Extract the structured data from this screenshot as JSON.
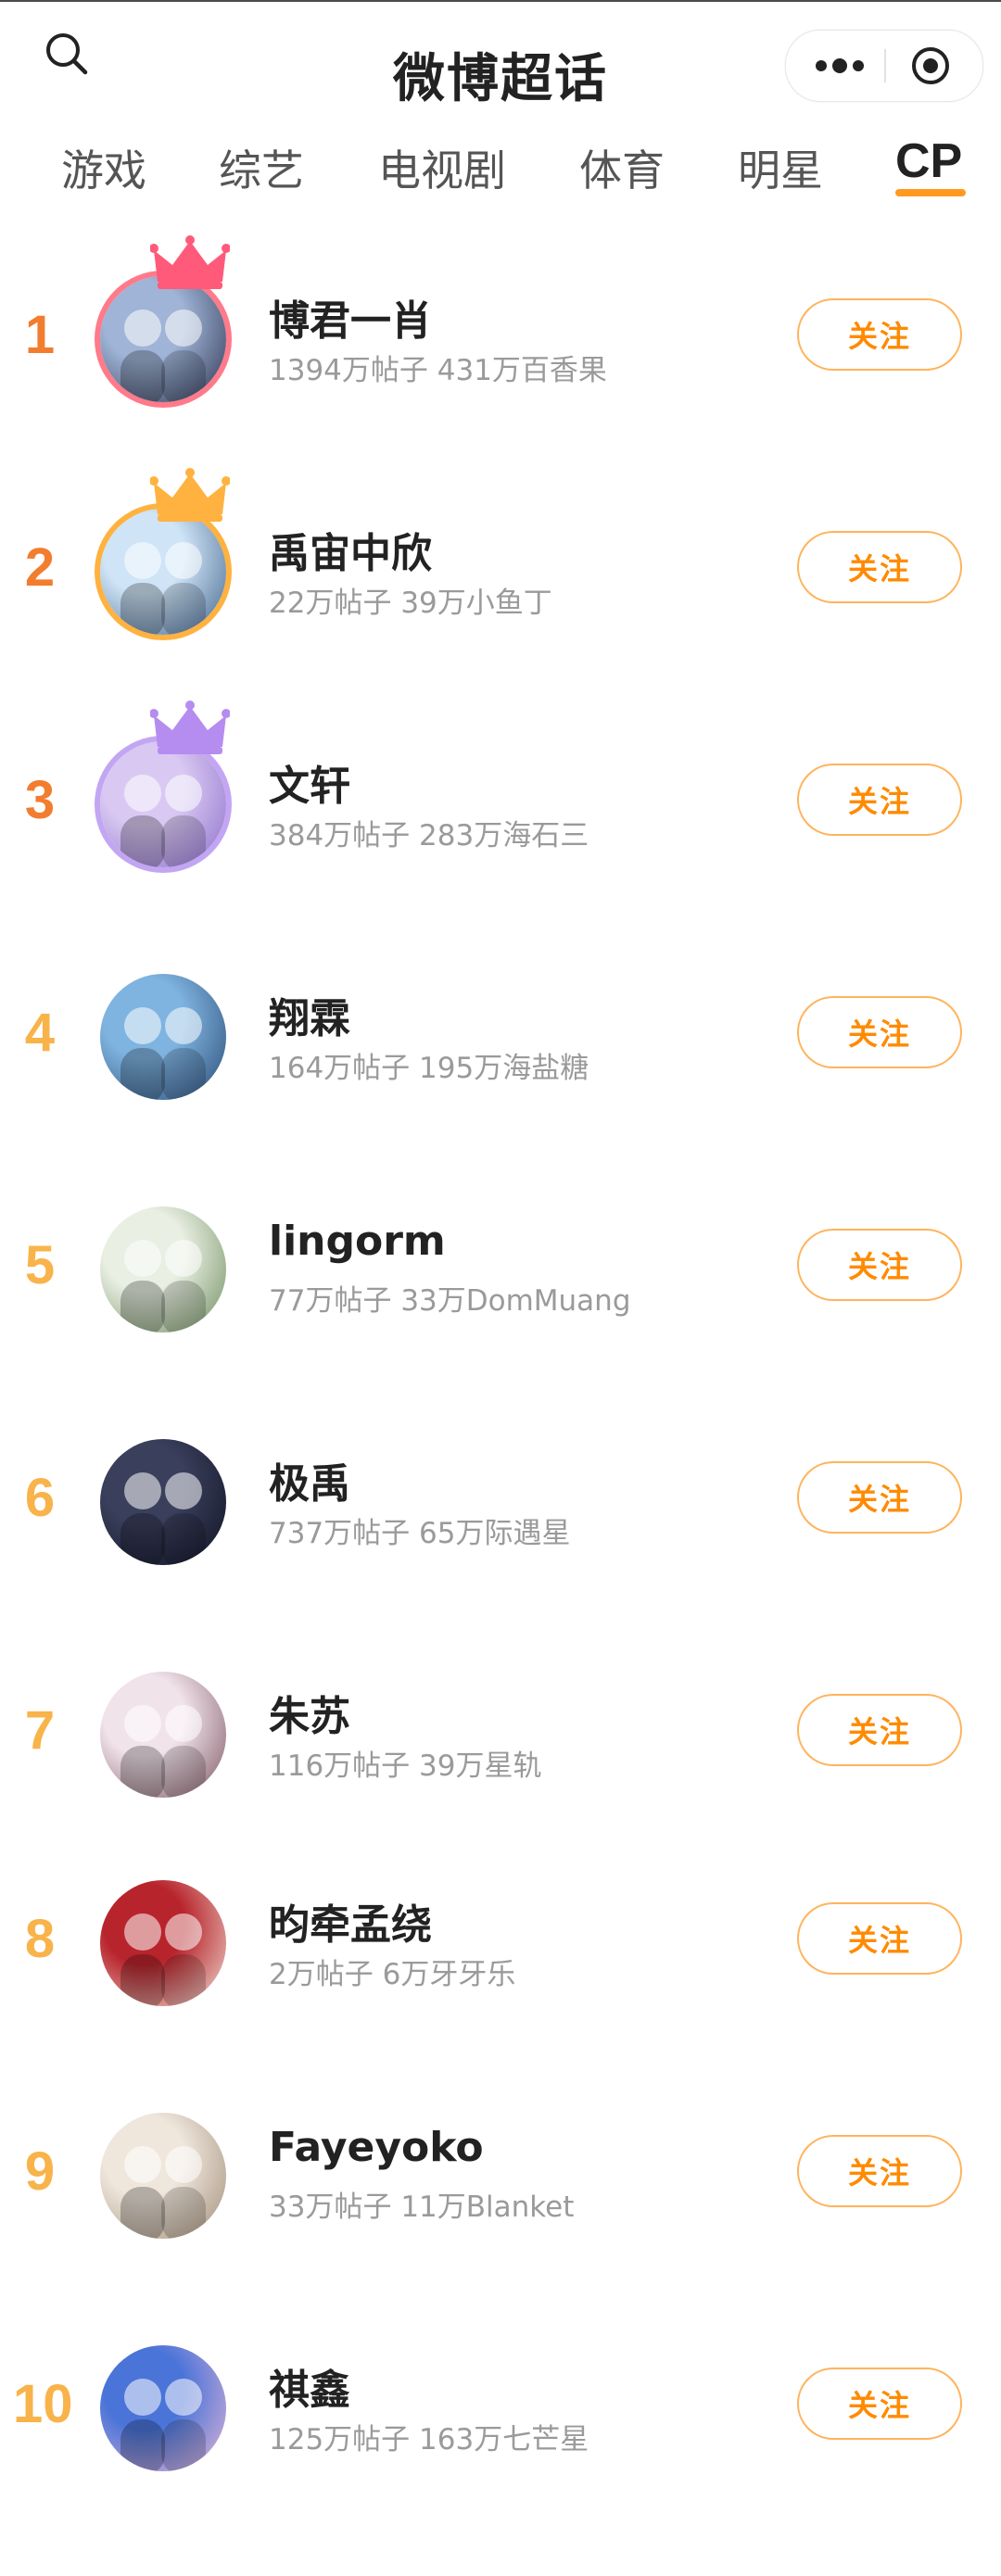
{
  "header": {
    "title": "微博超话",
    "search_icon": "search-icon",
    "more_icon": "more-dots-icon",
    "target_icon": "mini-program-close-icon"
  },
  "tabs": [
    {
      "label": "游戏",
      "active": false
    },
    {
      "label": "综艺",
      "active": false
    },
    {
      "label": "电视剧",
      "active": false
    },
    {
      "label": "体育",
      "active": false
    },
    {
      "label": "明星",
      "active": false
    },
    {
      "label": "CP",
      "active": true
    }
  ],
  "colors": {
    "accent": "#ff9a1f",
    "follow_text": "#ff8a00",
    "rank_top": "#f27d2f",
    "rank_other": "#f8b34a",
    "crown_1": "#ff5a7a",
    "crown_2": "#ffb23f",
    "crown_3": "#b58cf0"
  },
  "follow_label": "关注",
  "ranking": [
    {
      "rank": "1",
      "name": "博君一肖",
      "posts": "1394万帖子",
      "fans": "431万百香果",
      "crown": true,
      "ring": "#ff7a8a",
      "avatar": [
        "#9fb4d6",
        "#2a2f4a"
      ]
    },
    {
      "rank": "2",
      "name": "禹宙中欣",
      "posts": "22万帖子",
      "fans": "39万小鱼丁",
      "crown": true,
      "ring": "#ffb23f",
      "avatar": [
        "#cfe4f6",
        "#3d5f88"
      ]
    },
    {
      "rank": "3",
      "name": "文轩",
      "posts": "384万帖子",
      "fans": "283万海石三",
      "crown": true,
      "ring": "#c3a6f3",
      "avatar": [
        "#d9c9f2",
        "#8a6bc9"
      ]
    },
    {
      "rank": "4",
      "name": "翔霖",
      "posts": "164万帖子",
      "fans": "195万海盐糖",
      "crown": false,
      "ring": "",
      "avatar": [
        "#7fb3e0",
        "#27476f"
      ]
    },
    {
      "rank": "5",
      "name": "lingorm",
      "posts": "77万帖子",
      "fans": "33万DomMuang",
      "crown": false,
      "ring": "",
      "avatar": [
        "#e9efe3",
        "#6b8a5a"
      ]
    },
    {
      "rank": "6",
      "name": "极禹",
      "posts": "737万帖子",
      "fans": "65万际遇星",
      "crown": false,
      "ring": "",
      "avatar": [
        "#3a3f5c",
        "#0f1222"
      ]
    },
    {
      "rank": "7",
      "name": "朱苏",
      "posts": "116万帖子",
      "fans": "39万星轨",
      "crown": false,
      "ring": "",
      "avatar": [
        "#f1e3ea",
        "#7a5360"
      ]
    },
    {
      "rank": "8",
      "name": "昀牵孟绕",
      "posts": "2万帖子",
      "fans": "6万牙牙乐",
      "crown": false,
      "ring": "",
      "avatar": [
        "#b8242c",
        "#f0e4d8"
      ]
    },
    {
      "rank": "9",
      "name": "Fayeyoko",
      "posts": "33万帖子",
      "fans": "11万Blanket",
      "crown": false,
      "ring": "",
      "avatar": [
        "#efe6dc",
        "#9f8b76"
      ]
    },
    {
      "rank": "10",
      "name": "祺鑫",
      "posts": "125万帖子",
      "fans": "163万七芒星",
      "crown": false,
      "ring": "",
      "avatar": [
        "#4a74d8",
        "#e9b7d6"
      ]
    }
  ]
}
